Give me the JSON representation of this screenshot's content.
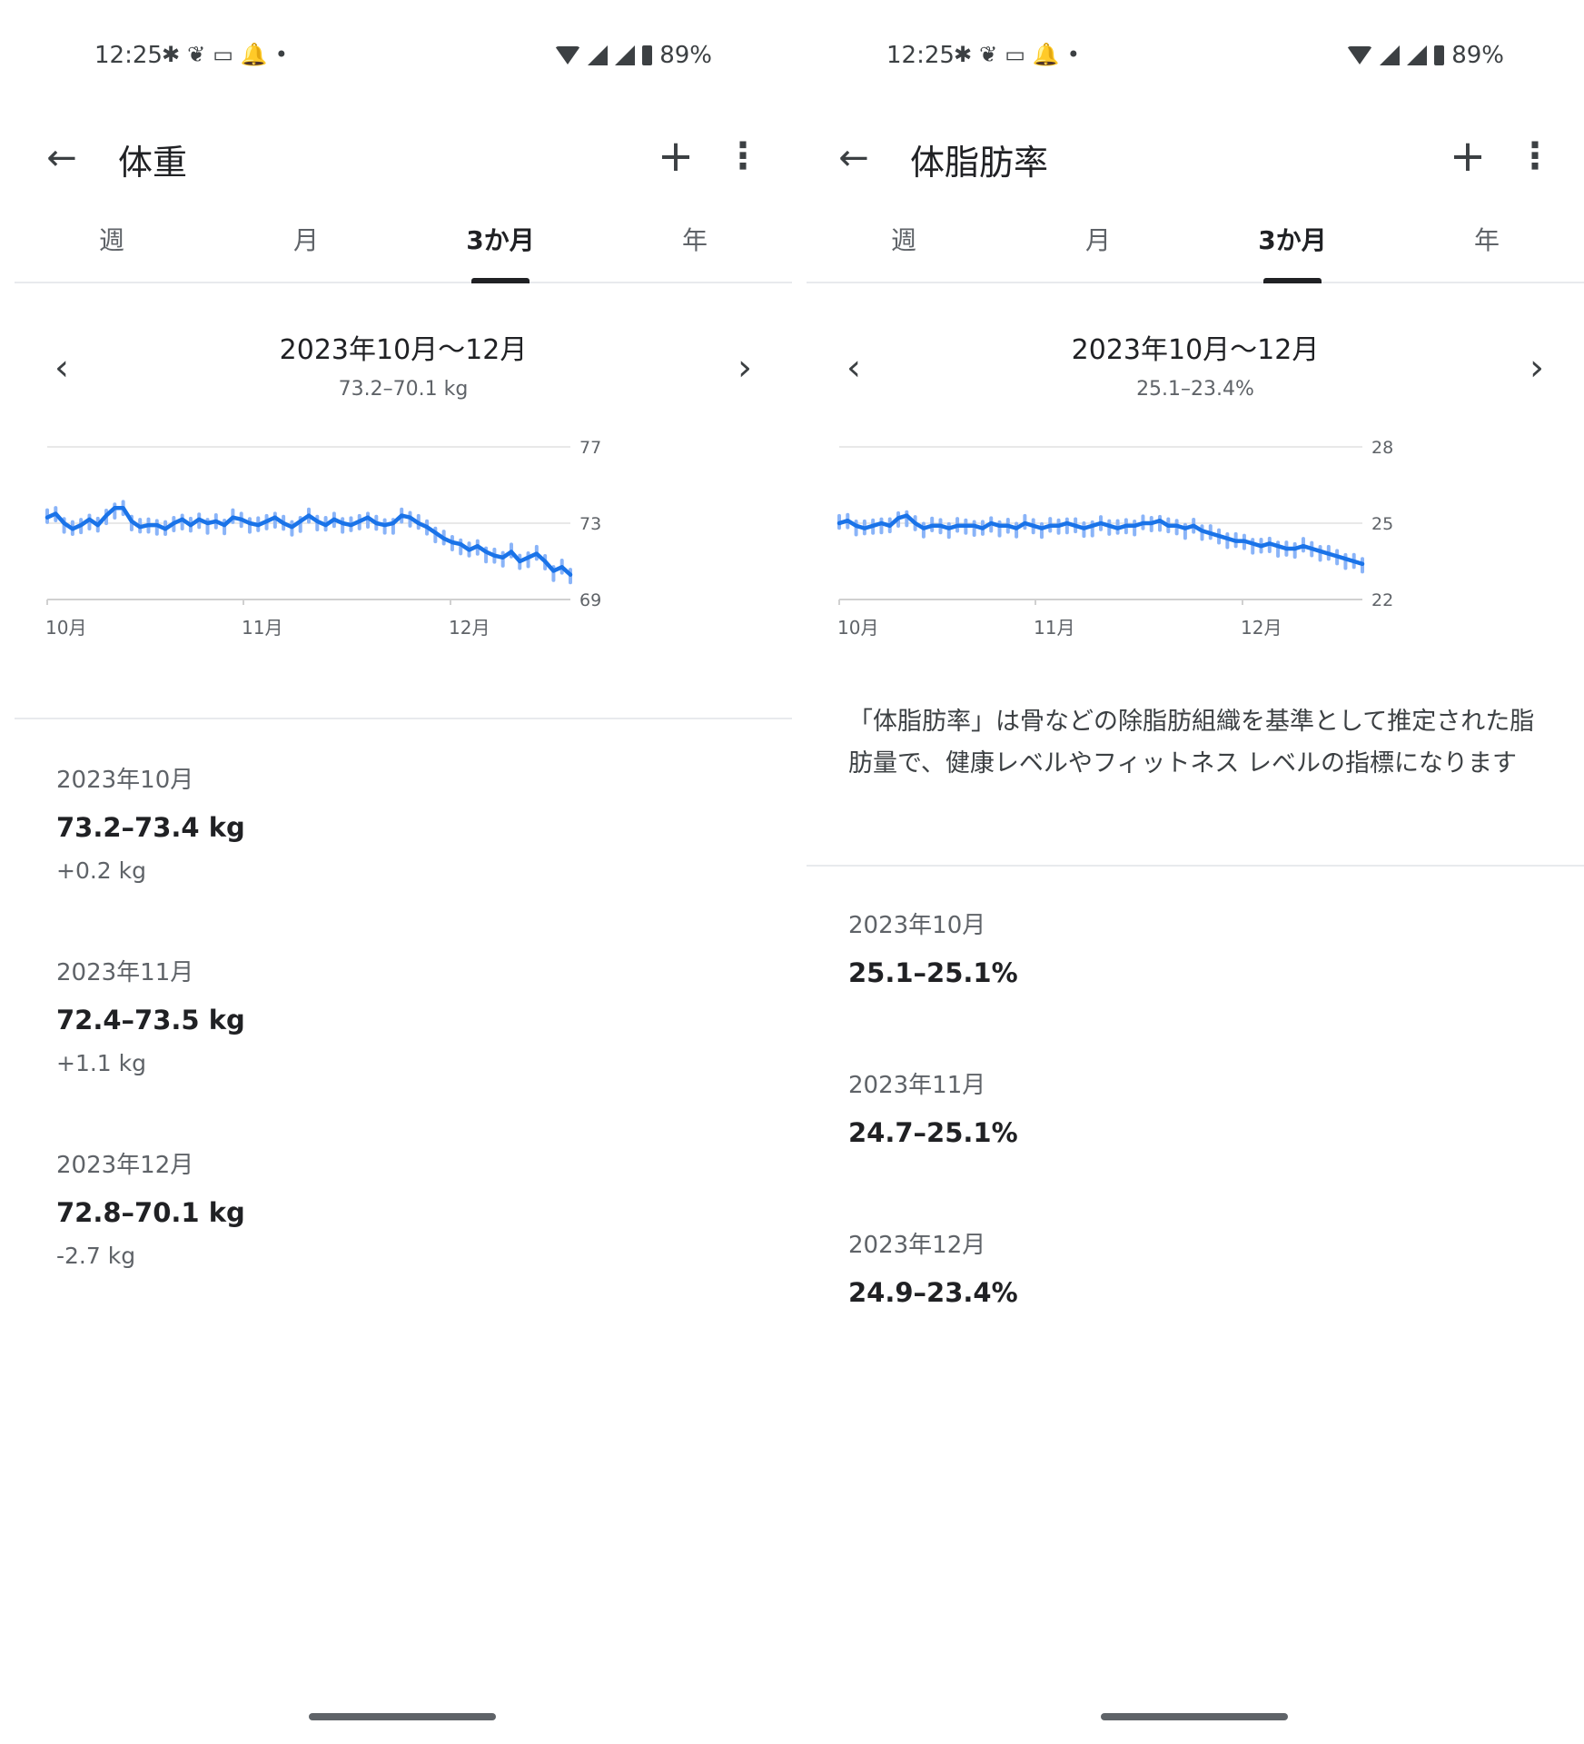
{
  "status": {
    "time": "12:25",
    "battery": "89%",
    "icons": [
      "slack-icon",
      "carrot-icon",
      "app-icon",
      "alarm-icon",
      "dot-icon"
    ]
  },
  "tabs": [
    "週",
    "月",
    "3か月",
    "年"
  ],
  "active_tab": 2,
  "left": {
    "title": "体重",
    "range_title": "2023年10月〜12月",
    "range_sub": "73.2–70.1 kg",
    "chart_data": {
      "type": "line",
      "title": "",
      "xlabel": "",
      "ylabel": "",
      "ylim": [
        69,
        77
      ],
      "y_ticks": [
        "77",
        "73",
        "69"
      ],
      "x_ticks": [
        "10月",
        "11月",
        "12月"
      ],
      "grid": true,
      "series": [
        {
          "values": [
            73.3,
            73.5,
            73.0,
            72.7,
            72.9,
            73.2,
            72.9,
            73.4,
            73.8,
            73.8,
            73.1,
            72.8,
            72.9,
            72.9,
            72.7,
            73.0,
            73.2,
            72.9,
            73.2,
            73.0,
            73.1,
            72.9,
            73.3,
            73.2,
            73.0,
            72.9,
            73.1,
            73.3,
            73.0,
            72.8,
            73.1,
            73.4,
            73.1,
            72.9,
            73.2,
            73.0,
            72.9,
            73.1,
            73.3,
            73.0,
            72.9,
            73.0,
            73.4,
            73.3,
            73.0,
            72.8,
            72.5,
            72.2,
            72.0,
            71.9,
            71.6,
            71.8,
            71.5,
            71.3,
            71.2,
            71.5,
            71.0,
            71.2,
            71.4,
            71.0,
            70.5,
            70.7,
            70.3
          ]
        }
      ]
    },
    "stats": [
      {
        "label": "2023年10月",
        "value": "73.2–73.4 kg",
        "change": "+0.2 kg"
      },
      {
        "label": "2023年11月",
        "value": "72.4–73.5 kg",
        "change": "+1.1 kg"
      },
      {
        "label": "2023年12月",
        "value": "72.8–70.1 kg",
        "change": "-2.7 kg"
      }
    ]
  },
  "right": {
    "title": "体脂肪率",
    "range_title": "2023年10月〜12月",
    "range_sub": "25.1–23.4%",
    "chart_data": {
      "type": "line",
      "title": "",
      "xlabel": "",
      "ylabel": "",
      "ylim": [
        22,
        28
      ],
      "y_ticks": [
        "28",
        "25",
        "22"
      ],
      "x_ticks": [
        "10月",
        "11月",
        "12月"
      ],
      "grid": true,
      "series": [
        {
          "values": [
            25.0,
            25.1,
            24.9,
            24.8,
            24.9,
            25.0,
            24.9,
            25.2,
            25.3,
            25.0,
            24.8,
            24.9,
            24.9,
            24.8,
            24.9,
            24.9,
            24.9,
            24.8,
            25.0,
            24.9,
            24.9,
            24.8,
            25.0,
            24.9,
            24.8,
            24.9,
            24.9,
            25.0,
            24.9,
            24.8,
            24.9,
            25.0,
            24.9,
            24.8,
            24.9,
            24.9,
            25.0,
            25.0,
            25.1,
            24.9,
            24.9,
            24.8,
            24.9,
            24.7,
            24.6,
            24.5,
            24.4,
            24.3,
            24.3,
            24.2,
            24.1,
            24.2,
            24.1,
            24.0,
            24.0,
            24.1,
            24.0,
            23.9,
            23.8,
            23.7,
            23.6,
            23.5,
            23.4
          ]
        }
      ]
    },
    "description": "「体脂肪率」は骨などの除脂肪組織を基準として推定された脂肪量で、健康レベルやフィットネス レベルの指標になります",
    "stats": [
      {
        "label": "2023年10月",
        "value": "25.1–25.1%"
      },
      {
        "label": "2023年11月",
        "value": "24.7–25.1%"
      },
      {
        "label": "2023年12月",
        "value": "24.9–23.4%"
      }
    ]
  },
  "colors": {
    "line": "#1a73e8",
    "dots": "#8ab4f8",
    "grid": "#e0e0e0",
    "axis_text": "#5f6368"
  }
}
